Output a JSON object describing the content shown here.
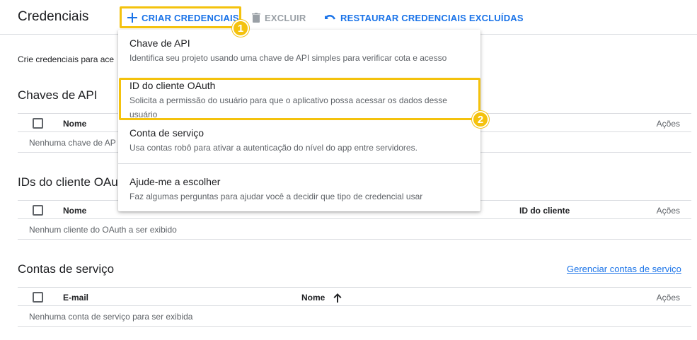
{
  "header": {
    "title": "Credenciais",
    "create_label": "CRIAR CREDENCIAIS",
    "delete_label": "EXCLUIR",
    "restore_label": "RESTAURAR CREDENCIAIS EXCLUÍDAS",
    "create_icon": "plus-icon",
    "delete_icon": "trash-icon",
    "restore_icon": "undo-icon"
  },
  "annotations": {
    "badge_1": "1",
    "badge_2": "2",
    "highlight_color": "#f4c20d"
  },
  "intro_text": "Crie credenciais para ace",
  "menu": {
    "items": [
      {
        "title": "Chave de API",
        "desc": "Identifica seu projeto usando uma chave de API simples para verificar cota e acesso"
      },
      {
        "title": "ID do cliente OAuth",
        "desc": "Solicita a permissão do usuário para que o aplicativo possa acessar os dados desse usuário"
      },
      {
        "title": "Conta de serviço",
        "desc": "Usa contas robô para ativar a autenticação do nível do app entre servidores."
      },
      {
        "title": "Ajude-me a escolher",
        "desc": "Faz algumas perguntas para ajudar você a decidir que tipo de credencial usar"
      }
    ]
  },
  "api_keys": {
    "title": "Chaves de API",
    "col_name": "Nome",
    "col_actions": "Ações",
    "empty": "Nenhuma chave de AP"
  },
  "oauth": {
    "title": "IDs do cliente OAu",
    "col_name": "Nome",
    "col_client_id": "ID do cliente",
    "col_actions": "Ações",
    "empty": "Nenhum cliente do OAuth a ser exibido"
  },
  "service_accounts": {
    "title": "Contas de serviço",
    "manage_link": "Gerenciar contas de serviço",
    "col_email": "E-mail",
    "col_name": "Nome",
    "col_actions": "Ações",
    "empty": "Nenhuma conta de serviço para ser exibida",
    "sort_icon": "arrow-up-icon"
  },
  "colors": {
    "accent": "#1a73e8",
    "muted": "#5f6368",
    "disabled": "#9aa0a6",
    "border": "#dadce0"
  }
}
